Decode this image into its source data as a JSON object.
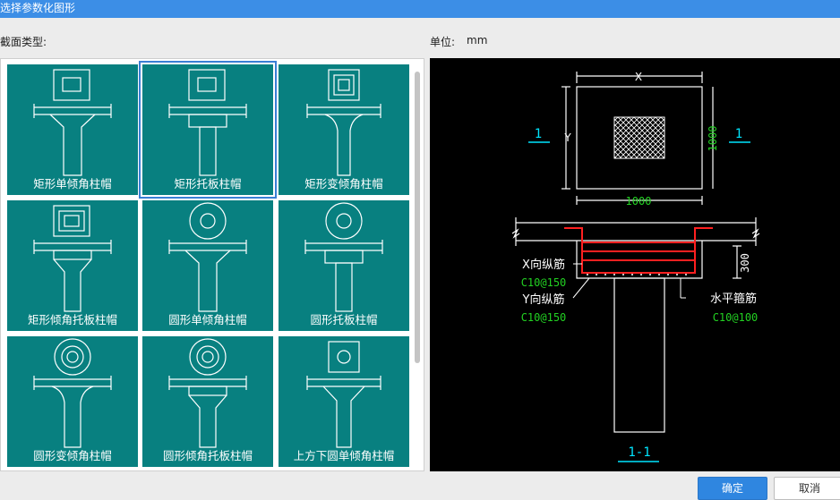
{
  "window": {
    "title": "选择参数化图形"
  },
  "labels": {
    "section_type": "截面类型:",
    "unit_label": "单位:",
    "unit_value": "mm"
  },
  "tiles": [
    {
      "caption": "矩形单倾角柱帽",
      "selected": false
    },
    {
      "caption": "矩形托板柱帽",
      "selected": true
    },
    {
      "caption": "矩形变倾角柱帽",
      "selected": false
    },
    {
      "caption": "矩形倾角托板柱帽",
      "selected": false
    },
    {
      "caption": "圆形单倾角柱帽",
      "selected": false
    },
    {
      "caption": "圆形托板柱帽",
      "selected": false
    },
    {
      "caption": "圆形变倾角柱帽",
      "selected": false
    },
    {
      "caption": "圆形倾角托板柱帽",
      "selected": false
    },
    {
      "caption": "上方下圆单倾角柱帽",
      "selected": false
    }
  ],
  "preview": {
    "dim_x": "X",
    "dim_y": "Y",
    "dim_bottom": "1000",
    "dim_right": "1000",
    "section_mark": "1",
    "rebar_x_label": "X向纵筋",
    "rebar_x_value": "C10@150",
    "rebar_y_label": "Y向纵筋",
    "rebar_y_value": "C10@150",
    "stirrup_label": "水平箍筋",
    "stirrup_value": "C10@100",
    "height_dim": "300",
    "section_title": "1-1"
  },
  "buttons": {
    "ok": "确定",
    "cancel": "取消"
  },
  "colors": {
    "titlebar": "#3c8ee6",
    "tile_bg": "#088080",
    "selection": "#3a7fd5",
    "primary_button": "#2f86e0",
    "rebar_red": "#ff2020",
    "dim_green": "#22d022",
    "mark_cyan": "#00e5ff"
  }
}
